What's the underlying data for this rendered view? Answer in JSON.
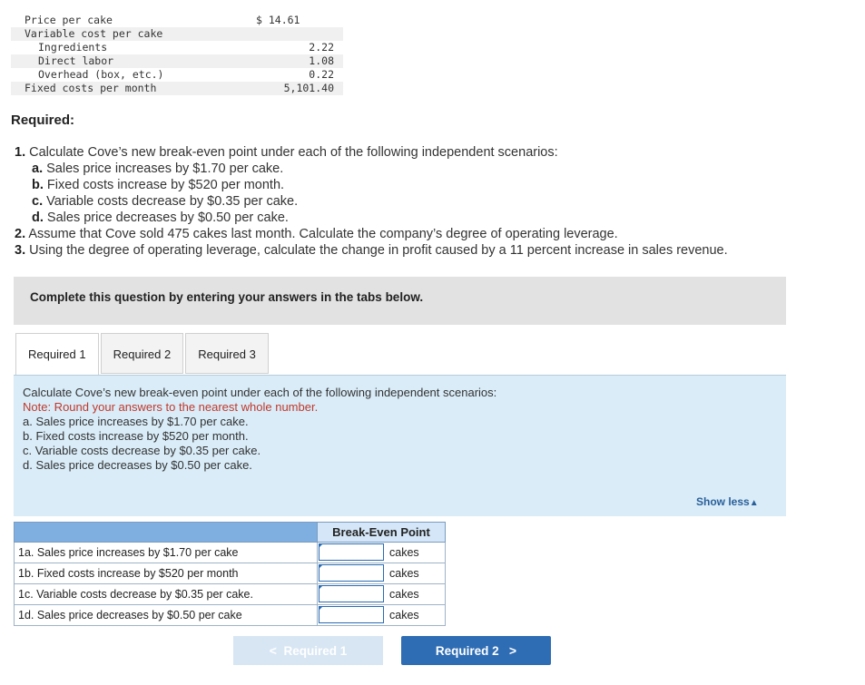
{
  "cost_table": {
    "rows": [
      {
        "label": "Price per cake",
        "value": "$ 14.61",
        "indent": 0,
        "shade": false,
        "currency": true
      },
      {
        "label": "Variable cost per cake",
        "value": "",
        "indent": 0,
        "shade": true,
        "currency": false
      },
      {
        "label": "Ingredients",
        "value": "2.22",
        "indent": 1,
        "shade": false,
        "currency": false
      },
      {
        "label": "Direct labor",
        "value": "1.08",
        "indent": 1,
        "shade": true,
        "currency": false
      },
      {
        "label": "Overhead (box, etc.)",
        "value": "0.22",
        "indent": 1,
        "shade": false,
        "currency": false
      },
      {
        "label": "Fixed costs per month",
        "value": "5,101.40",
        "indent": 0,
        "shade": true,
        "currency": false
      }
    ]
  },
  "required": {
    "heading": "Required:",
    "items": [
      {
        "num": "1.",
        "text": "Calculate Cove’s new break-even point under each of the following independent scenarios:",
        "sub": false
      },
      {
        "num": "a.",
        "text": "Sales price increases by $1.70 per cake.",
        "sub": true
      },
      {
        "num": "b.",
        "text": "Fixed costs increase by $520 per month.",
        "sub": true
      },
      {
        "num": "c.",
        "text": "Variable costs decrease by $0.35 per cake.",
        "sub": true
      },
      {
        "num": "d.",
        "text": "Sales price decreases by $0.50 per cake.",
        "sub": true
      },
      {
        "num": "2.",
        "text": "Assume that Cove sold 475 cakes last month. Calculate the company’s degree of operating leverage.",
        "sub": false
      },
      {
        "num": "3.",
        "text": "Using the degree of operating leverage, calculate the change in profit caused by a 11 percent increase in sales revenue.",
        "sub": false
      }
    ]
  },
  "instruction": "Complete this question by entering your answers in the tabs below.",
  "tabs": [
    {
      "label": "Required 1",
      "active": true
    },
    {
      "label": "Required 2",
      "active": false
    },
    {
      "label": "Required 3",
      "active": false
    }
  ],
  "panel": {
    "intro": "Calculate Cove’s new break-even point under each of the following independent scenarios:",
    "note": "Note: Round your answers to the nearest whole number.",
    "lines": [
      "a. Sales price increases by $1.70 per cake.",
      "b. Fixed costs increase by $520 per month.",
      "c. Variable costs decrease by $0.35 per cake.",
      "d. Sales price decreases by $0.50 per cake."
    ],
    "show_less": "Show less"
  },
  "answer_table": {
    "column_header": "Break-Even Point",
    "rows": [
      {
        "label": "1a. Sales price increases by $1.70 per cake",
        "value": "",
        "unit": "cakes"
      },
      {
        "label": "1b. Fixed costs increase by $520 per month",
        "value": "",
        "unit": "cakes"
      },
      {
        "label": "1c. Variable costs decrease by $0.35 per cake.",
        "value": "",
        "unit": "cakes"
      },
      {
        "label": "1d. Sales price decreases by $0.50 per cake",
        "value": "",
        "unit": "cakes"
      }
    ]
  },
  "nav": {
    "prev_label": "Required 1",
    "next_label": "Required 2"
  },
  "colors": {
    "panel_bg": "#d9ecf8",
    "header_blue": "#7eafe0",
    "next_button": "#2e6db4",
    "prev_button": "#d8e6f3",
    "note_red": "#c0392b",
    "link_blue": "#2a5f99"
  }
}
